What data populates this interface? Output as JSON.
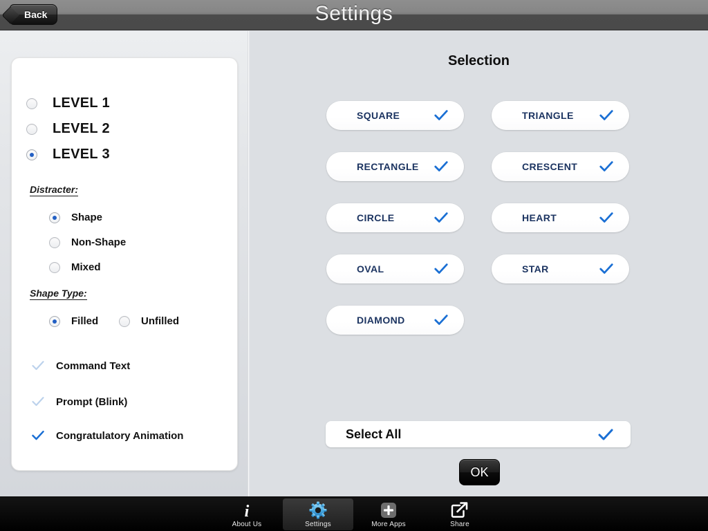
{
  "header": {
    "title": "Settings",
    "back_label": "Back",
    "back_icon": "back-arrow-icon"
  },
  "left_panel": {
    "levels": [
      {
        "label": "LEVEL 1",
        "selected": false
      },
      {
        "label": "LEVEL 2",
        "selected": false
      },
      {
        "label": "LEVEL 3",
        "selected": true
      }
    ],
    "distracter": {
      "title": "Distracter:",
      "options": [
        {
          "label": "Shape",
          "selected": true
        },
        {
          "label": "Non-Shape",
          "selected": false
        },
        {
          "label": "Mixed",
          "selected": false
        }
      ]
    },
    "shape_type": {
      "title": "Shape Type:",
      "options": [
        {
          "label": "Filled",
          "selected": true
        },
        {
          "label": "Unfilled",
          "selected": false
        }
      ]
    },
    "toggles": [
      {
        "label": "Command Text",
        "checked": false
      },
      {
        "label": "Prompt (Blink)",
        "checked": false
      },
      {
        "label": "Congratulatory Animation",
        "checked": true
      }
    ]
  },
  "right_panel": {
    "title": "Selection",
    "shapes": [
      {
        "label": "SQUARE",
        "checked": true
      },
      {
        "label": "TRIANGLE",
        "checked": true
      },
      {
        "label": "RECTANGLE",
        "checked": true
      },
      {
        "label": "CRESCENT",
        "checked": true
      },
      {
        "label": "CIRCLE",
        "checked": true
      },
      {
        "label": "HEART",
        "checked": true
      },
      {
        "label": "OVAL",
        "checked": true
      },
      {
        "label": "STAR",
        "checked": true
      },
      {
        "label": "DIAMOND",
        "checked": true
      }
    ],
    "select_all": {
      "label": "Select All",
      "checked": true
    },
    "ok_label": "OK"
  },
  "tabbar": {
    "items": [
      {
        "label": "About Us",
        "icon": "info-icon",
        "active": false
      },
      {
        "label": "Settings",
        "icon": "gear-icon",
        "active": true
      },
      {
        "label": "More Apps",
        "icon": "plus-icon",
        "active": false
      },
      {
        "label": "Share",
        "icon": "share-icon",
        "active": false
      }
    ]
  },
  "colors": {
    "accent_blue": "#2360c4",
    "check_blue": "#1a6fd4",
    "check_faded": "#bcd2ec",
    "shape_text": "#1c3461",
    "gear_blue": "#4db2e8"
  }
}
